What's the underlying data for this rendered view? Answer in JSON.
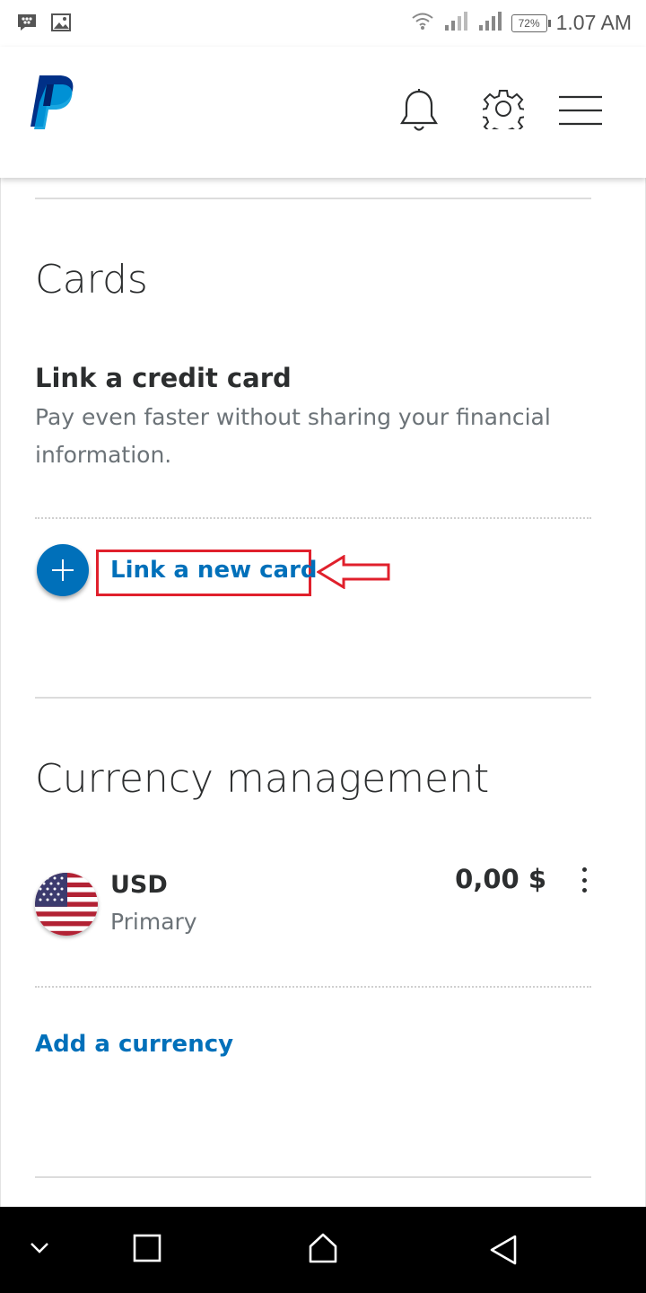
{
  "status_bar": {
    "time": "1.07 AM",
    "battery": "72%",
    "icons": [
      "bbm-icon",
      "gallery-icon",
      "wifi-icon",
      "signal-icon",
      "signal-icon",
      "battery-icon"
    ]
  },
  "header": {
    "logo": "paypal-logo",
    "icons": [
      "bell-icon",
      "gear-icon",
      "menu-icon"
    ]
  },
  "cards": {
    "title": "Cards",
    "subtitle": "Link a credit card",
    "description": "Pay even faster without sharing your financial information.",
    "link_new_card": "Link a new card"
  },
  "currency": {
    "title": "Currency management",
    "code": "USD",
    "label": "Primary",
    "amount": "0,00 $",
    "add_currency": "Add a currency"
  },
  "colors": {
    "accent": "#0070ba",
    "highlight": "#e0202c",
    "text": "#2c2e2f",
    "muted": "#6c7378"
  },
  "nav_bar": {
    "icons": [
      "chevron-down-icon",
      "recents-icon",
      "home-icon",
      "back-icon"
    ]
  }
}
